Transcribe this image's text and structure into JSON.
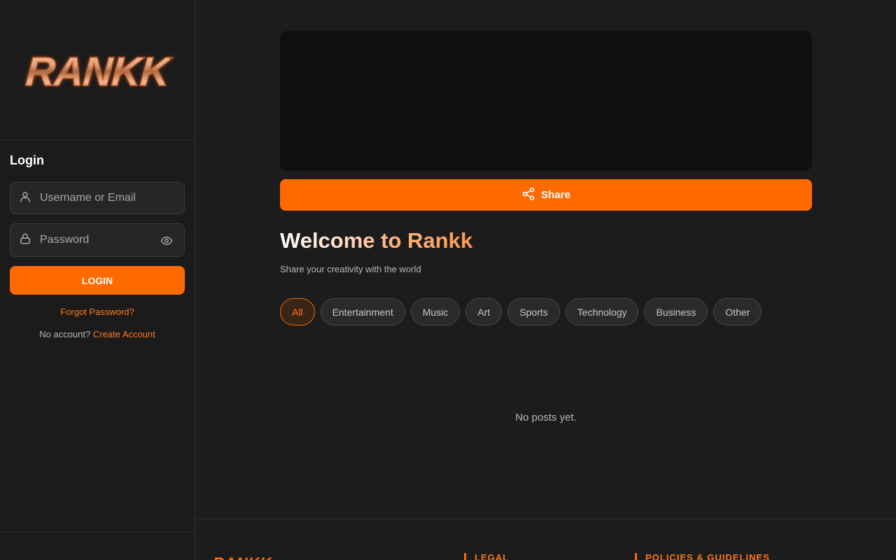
{
  "brand": {
    "logo_text": "RANKK",
    "accent": "#ff6a00"
  },
  "sidebar": {
    "login": {
      "title": "Login",
      "username_placeholder": "Username or Email",
      "password_placeholder": "Password",
      "login_label": "LOGIN",
      "forgot_label": "Forgot Password?",
      "no_account_text": "No account?",
      "create_account_label": "Create Account"
    }
  },
  "main": {
    "share_label": "Share",
    "welcome_title": "Welcome to Rankk",
    "subtitle": "Share your creativity with the world",
    "categories": [
      "All",
      "Entertainment",
      "Music",
      "Art",
      "Sports",
      "Technology",
      "Business",
      "Other"
    ],
    "active_category": "All",
    "empty_text": "No posts yet."
  },
  "footer": {
    "logo_text": "RANKK",
    "legal_heading": "LEGAL",
    "policies_heading": "POLICIES & GUIDELINES"
  }
}
